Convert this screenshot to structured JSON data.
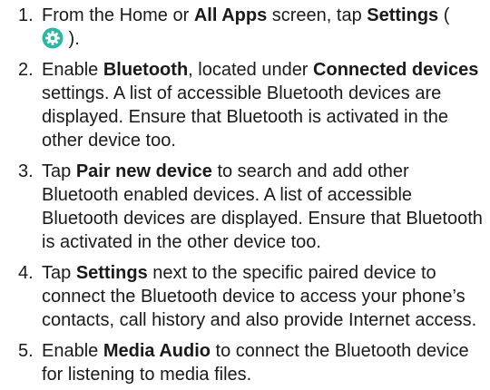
{
  "steps": [
    {
      "number": "1.",
      "parts": {
        "t1": "From the Home or ",
        "b1": "All Apps",
        "t2": " screen, tap ",
        "b2": "Settings",
        "t3": " (",
        "t4": " )."
      },
      "icon": "settings-gear-icon",
      "icon_color": "#2fb7a3"
    },
    {
      "number": "2.",
      "parts": {
        "t1": "Enable ",
        "b1": "Bluetooth",
        "t2": ", located under ",
        "b2": "Connected devices",
        "t3": " settings. A list of accessible Bluetooth devices are displayed. Ensure that Bluetooth is activated in the other device too."
      }
    },
    {
      "number": "3.",
      "parts": {
        "t1": "Tap ",
        "b1": "Pair new device",
        "t2": " to search and add other Bluetooth enabled devices. A list of accessible Bluetooth devices are displayed. Ensure that Bluetooth is activated in the other device too."
      }
    },
    {
      "number": "4.",
      "parts": {
        "t1": "Tap ",
        "b1": "Settings",
        "t2": " next to the specific paired device to connect the Bluetooth device to access your phone’s contacts, call history and also provide Internet access."
      }
    },
    {
      "number": "5.",
      "parts": {
        "t1": "Enable ",
        "b1": "Media Audio",
        "t2": " to connect the Bluetooth device for listening to media files."
      }
    }
  ]
}
